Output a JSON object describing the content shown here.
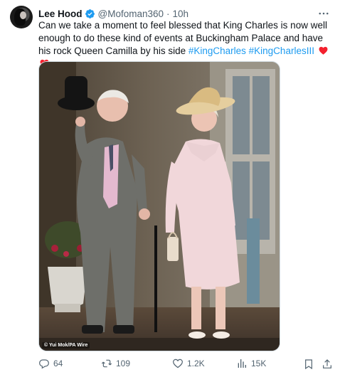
{
  "user": {
    "display_name": "Lee Hood",
    "handle": "@Mofoman360",
    "separator": "·",
    "time": "10h"
  },
  "tweet": {
    "text": "Can we take a moment to feel blessed that King Charles is now well enough to do these kind of events at Buckingham Palace and have his rock Queen Camilla by his side ",
    "hashtags": [
      "#KingCharles",
      "#KingCharlesIII"
    ],
    "emoji": [
      "red-heart-icon",
      "red-heart-icon"
    ]
  },
  "media": {
    "credit": "© Yui Mok/PA Wire"
  },
  "metrics": {
    "replies": "64",
    "retweets": "109",
    "likes": "1.2K",
    "views": "15K"
  },
  "colors": {
    "accent": "#1d9bf0",
    "muted": "#536471",
    "heart": "#f4212e"
  }
}
